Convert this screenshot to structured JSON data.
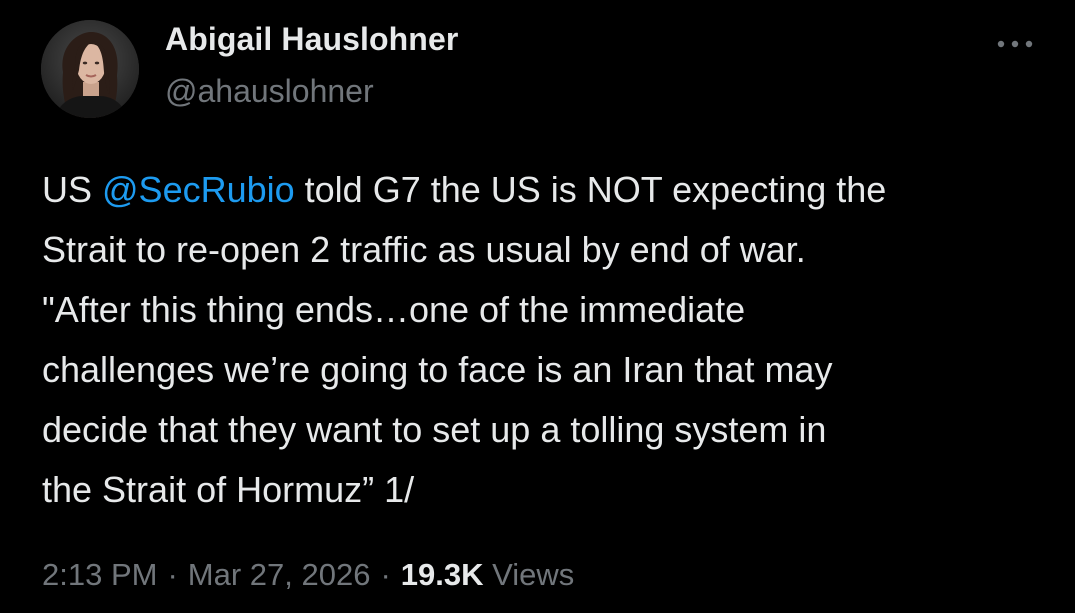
{
  "author": {
    "display_name": "Abigail Hauslohner",
    "handle": "@ahauslohner"
  },
  "tweet": {
    "lines": [
      {
        "before": "US ",
        "mention": "@SecRubio",
        "after": " told G7 the US is NOT expecting the"
      },
      {
        "text": "Strait to re-open 2 traffic as usual by end of war."
      },
      {
        "text": "\"After this thing ends…one of the immediate"
      },
      {
        "text": "challenges we’re going to face is an Iran that may"
      },
      {
        "text": "decide that they want to set up a tolling system in"
      },
      {
        "text": "the Strait of Hormuz” 1/"
      }
    ]
  },
  "meta": {
    "time": "2:13 PM",
    "separator": "·",
    "date": "Mar 27, 2026",
    "views_count": "19.3K",
    "views_label": "Views"
  },
  "icons": {
    "more": "more-horizontal-icon",
    "avatar": "profile-photo"
  },
  "colors": {
    "background": "#000000",
    "text_primary": "#e7e9ea",
    "text_secondary": "#71767b",
    "link": "#1d9bf0"
  }
}
